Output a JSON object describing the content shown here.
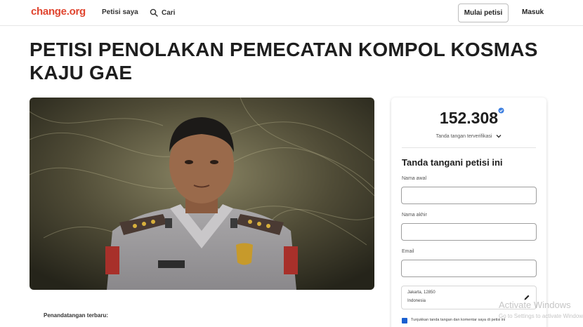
{
  "header": {
    "logo": "change.org",
    "nav_petisi": "Petisi saya",
    "nav_cari": "Cari",
    "start_button": "Mulai petisi",
    "login": "Masuk"
  },
  "petition": {
    "title": "PETISI PENOLAKAN PEMECATAN KOMPOL KOSMAS KAJU GAE",
    "recent_signers_label": "Penandatangan terbaru:"
  },
  "sign_card": {
    "count": "152.308",
    "verified_label": "Tanda tangan terverifikasi",
    "heading": "Tanda tangani petisi ini",
    "first_name_label": "Nama awal",
    "first_name_value": "",
    "last_name_label": "Nama akhir",
    "last_name_value": "",
    "email_label": "Email",
    "email_value": "",
    "location_line1": "Jakarta, 12850",
    "location_line2": "Indonesia",
    "show_comment_label": "Tunjukkan tanda tangan dan komentar saya di petisi ini"
  },
  "watermark": {
    "line1": "Activate Windows",
    "line2": "Go to Settings to activate Windows."
  },
  "colors": {
    "brand": "#e0452f",
    "verified_blue": "#3d7fe0",
    "checkbox_blue": "#1a5fd0"
  }
}
